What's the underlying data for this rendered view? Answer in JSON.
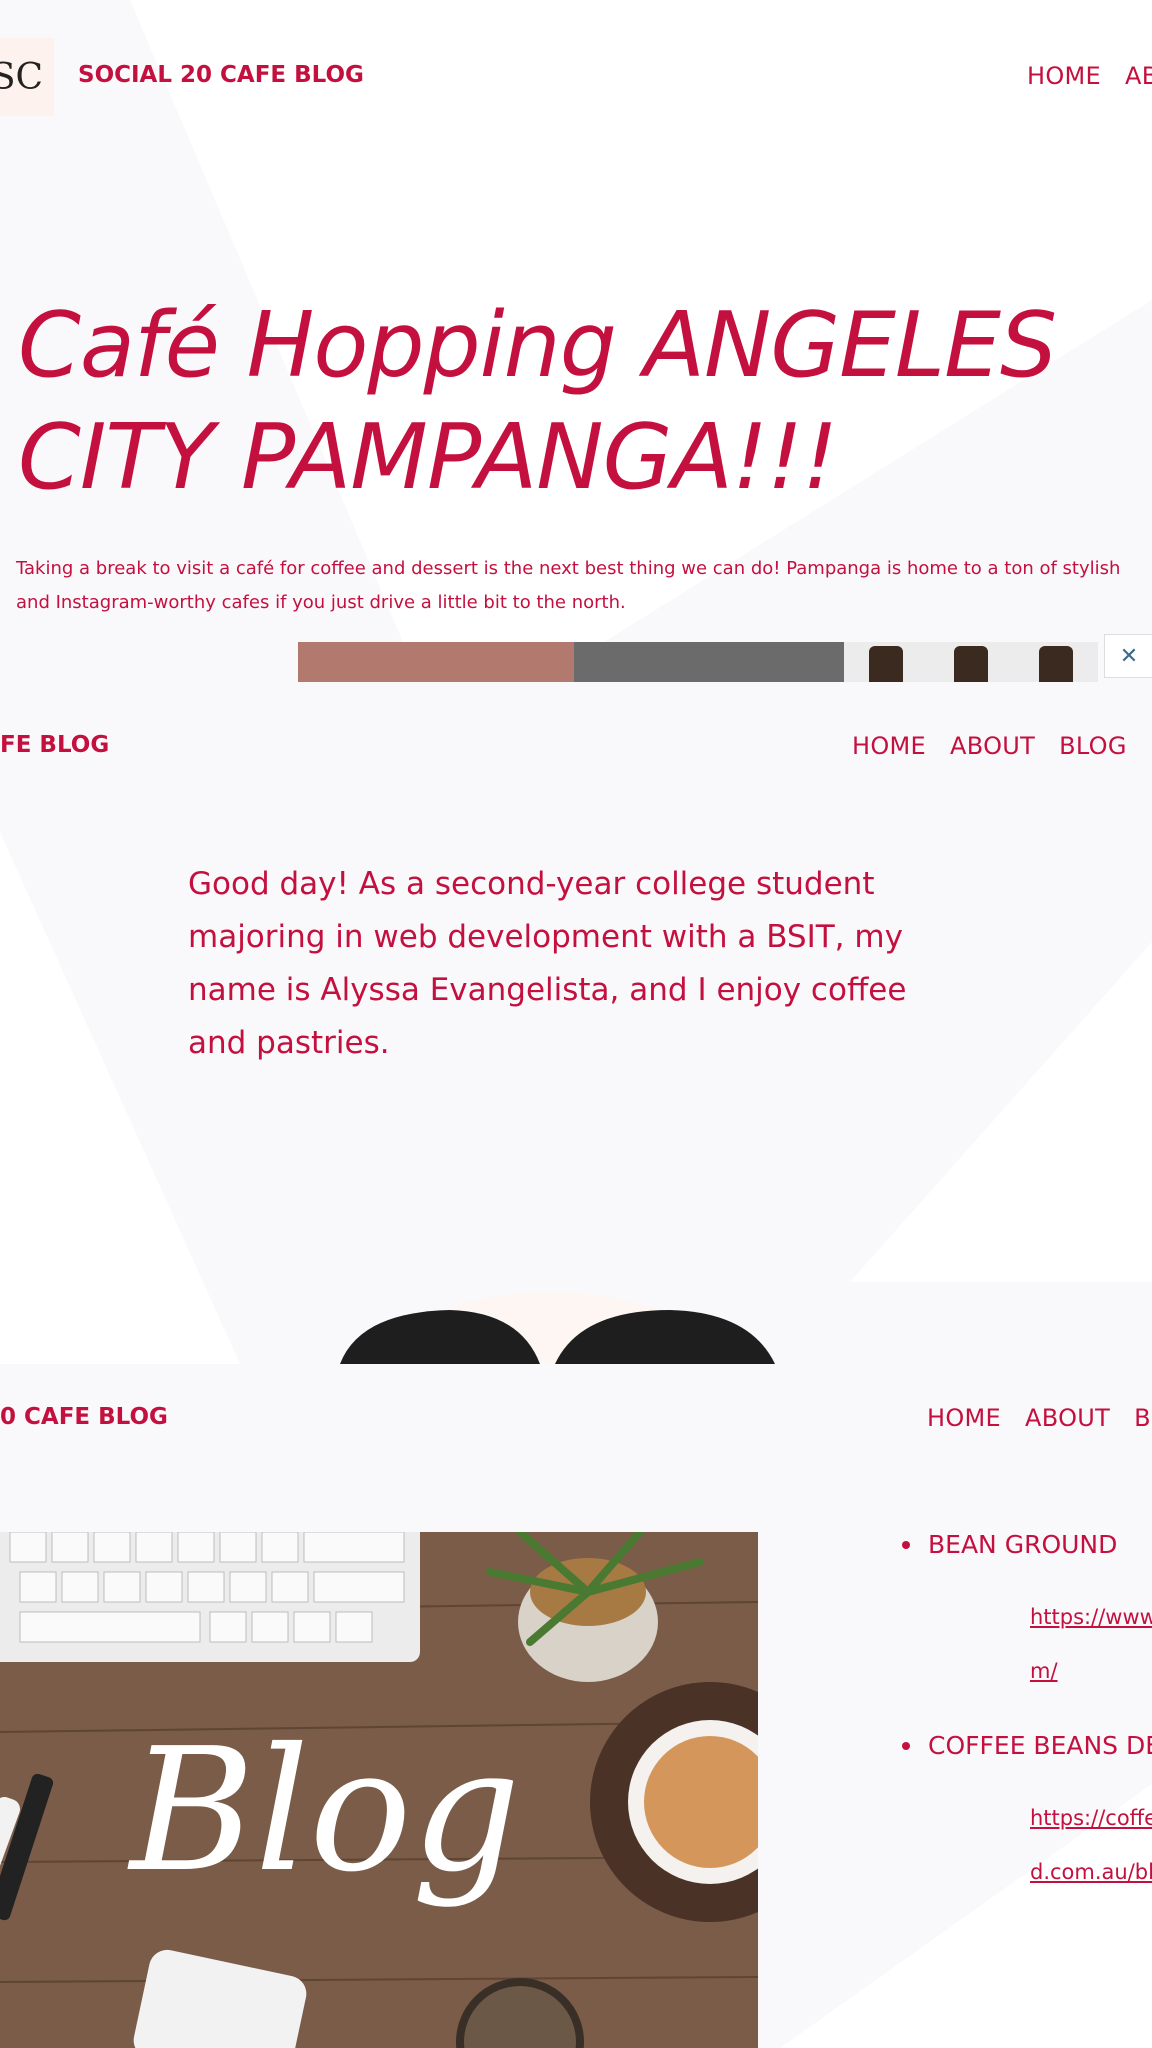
{
  "site": {
    "title_full": "SOCIAL 20 CAFE BLOG",
    "title_cropped_2": "FE BLOG",
    "title_cropped_3": "0 CAFE BLOG",
    "logo_text": "SC"
  },
  "nav": {
    "home": "HOME",
    "about_cropped": "AB",
    "about": "ABOUT",
    "blog": "BLOG",
    "blog_cropped": "B"
  },
  "home_section": {
    "heading": "Café Hopping ANGELES CITY PAMPANGA!!!",
    "intro": "Taking a break to visit a café for coffee and dessert is the next best thing we can do! Pampanga is home to a ton of stylish and Instagram-worthy cafes if you just drive a little bit to the north."
  },
  "about_section": {
    "text": "Good day! As a second-year college student majoring in web development with a BSIT, my name is Alyssa Evangelista, and I enjoy coffee and pastries."
  },
  "blog_section": {
    "image_text": "Blog",
    "resources": [
      {
        "name": "BEAN GROUND",
        "link_line1": "https://www.",
        "link_line2": "m/"
      },
      {
        "name": "COFFEE BEANS DE",
        "link_line1": "https://coffe",
        "link_line2": "d.com.au/blo"
      }
    ]
  },
  "icons": {
    "tool": "tools-icon"
  },
  "colors": {
    "accent": "#c4103f",
    "background": "#f9f8fb"
  }
}
